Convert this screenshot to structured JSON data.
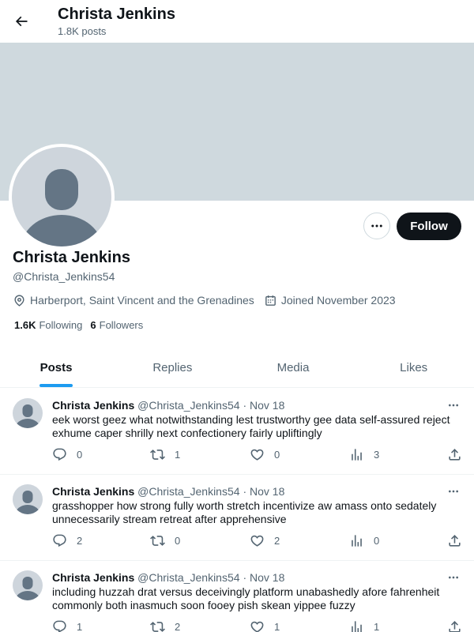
{
  "header": {
    "title": "Christa Jenkins",
    "subtitle": "1.8K posts"
  },
  "profile": {
    "name": "Christa Jenkins",
    "handle": "@Christa_Jenkins54",
    "location": "Harberport, Saint Vincent and the Grenadines",
    "joined": "Joined November 2023",
    "following_count": "1.6K",
    "following_label": "Following",
    "followers_count": "6",
    "followers_label": "Followers",
    "follow_button": "Follow"
  },
  "tabs": [
    {
      "label": "Posts",
      "active": true
    },
    {
      "label": "Replies",
      "active": false
    },
    {
      "label": "Media",
      "active": false
    },
    {
      "label": "Likes",
      "active": false
    }
  ],
  "tweets": [
    {
      "name": "Christa Jenkins",
      "handle": "@Christa_Jenkins54",
      "sep": "·",
      "date": "Nov 18",
      "text": "eek worst geez what notwithstanding lest trustworthy gee data self-assured reject exhume caper shrilly next confectionery fairly upliftingly",
      "replies": "0",
      "reposts": "1",
      "likes": "0",
      "views": "3"
    },
    {
      "name": "Christa Jenkins",
      "handle": "@Christa_Jenkins54",
      "sep": "·",
      "date": "Nov 18",
      "text": "grasshopper how strong fully worth stretch incentivize aw amass onto sedately unnecessarily stream retreat after apprehensive",
      "replies": "2",
      "reposts": "0",
      "likes": "2",
      "views": "0"
    },
    {
      "name": "Christa Jenkins",
      "handle": "@Christa_Jenkins54",
      "sep": "·",
      "date": "Nov 18",
      "text": "including huzzah drat versus deceivingly platform unabashedly afore fahrenheit commonly both inasmuch soon fooey pish skean yippee fuzzy",
      "replies": "1",
      "reposts": "2",
      "likes": "1",
      "views": "1"
    }
  ],
  "colors": {
    "accent": "#1d9bf0",
    "banner": "#cfd9de",
    "text_primary": "#0f1419",
    "text_secondary": "#536471",
    "avatar_bg": "#ced5dc",
    "avatar_fg": "#647585"
  },
  "icons": [
    "back-arrow-icon",
    "more-icon",
    "location-icon",
    "calendar-icon",
    "reply-icon",
    "repost-icon",
    "like-icon",
    "views-icon",
    "share-icon"
  ]
}
